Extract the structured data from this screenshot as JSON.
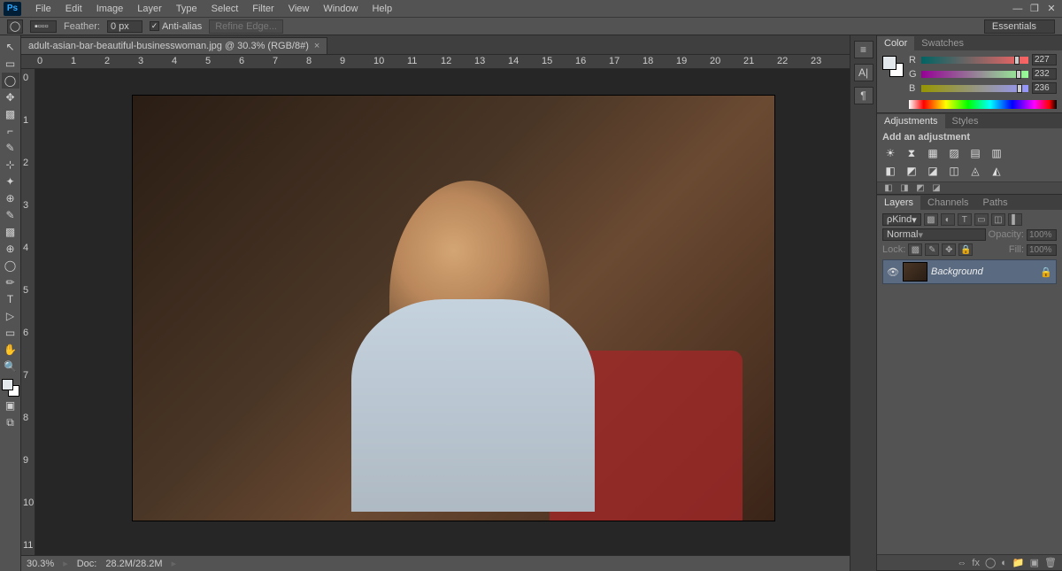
{
  "menubar": [
    "File",
    "Edit",
    "Image",
    "Layer",
    "Type",
    "Select",
    "Filter",
    "View",
    "Window",
    "Help"
  ],
  "options": {
    "feather_label": "Feather:",
    "feather_value": "0 px",
    "antialias_label": "Anti-alias",
    "refine_label": "Refine Edge...",
    "workspace": "Essentials"
  },
  "document": {
    "tab_title": "adult-asian-bar-beautiful-businesswoman.jpg @ 30.3% (RGB/8#)"
  },
  "ruler_h": [
    "0",
    "1",
    "2",
    "3",
    "4",
    "5",
    "6",
    "7",
    "8",
    "9",
    "10",
    "11",
    "12",
    "13",
    "14",
    "15",
    "16",
    "17",
    "18",
    "19",
    "20",
    "21",
    "22",
    "23"
  ],
  "ruler_v": [
    "0",
    "1",
    "2",
    "3",
    "4",
    "5",
    "6",
    "7",
    "8",
    "9",
    "10",
    "11"
  ],
  "status": {
    "zoom": "30.3%",
    "doc_label": "Doc:",
    "doc_info": "28.2M/28.2M"
  },
  "panels": {
    "color": {
      "tab1": "Color",
      "tab2": "Swatches",
      "r": "R",
      "g": "G",
      "b": "B",
      "rv": "227",
      "gv": "232",
      "bv": "236"
    },
    "adjustments": {
      "tab1": "Adjustments",
      "tab2": "Styles",
      "title": "Add an adjustment"
    },
    "layers": {
      "tab1": "Layers",
      "tab2": "Channels",
      "tab3": "Paths",
      "filter": "Kind",
      "blend": "Normal",
      "opacity_label": "Opacity:",
      "opacity": "100%",
      "lock_label": "Lock:",
      "fill_label": "Fill:",
      "fill": "100%",
      "bg_name": "Background"
    }
  },
  "tool_icons": [
    "↖",
    "▭",
    "◯",
    "✥",
    "▩",
    "⌐",
    "✎",
    "⊹",
    "✦",
    "⊕",
    "✏",
    "T",
    "▷",
    "✋",
    "🔍"
  ],
  "adj_icons_row1": [
    "☀",
    "⧗",
    "▦",
    "▨",
    "▤",
    "▥"
  ],
  "adj_icons_row2": [
    "◧",
    "◩",
    "◪",
    "◫",
    "◬",
    "◭"
  ]
}
